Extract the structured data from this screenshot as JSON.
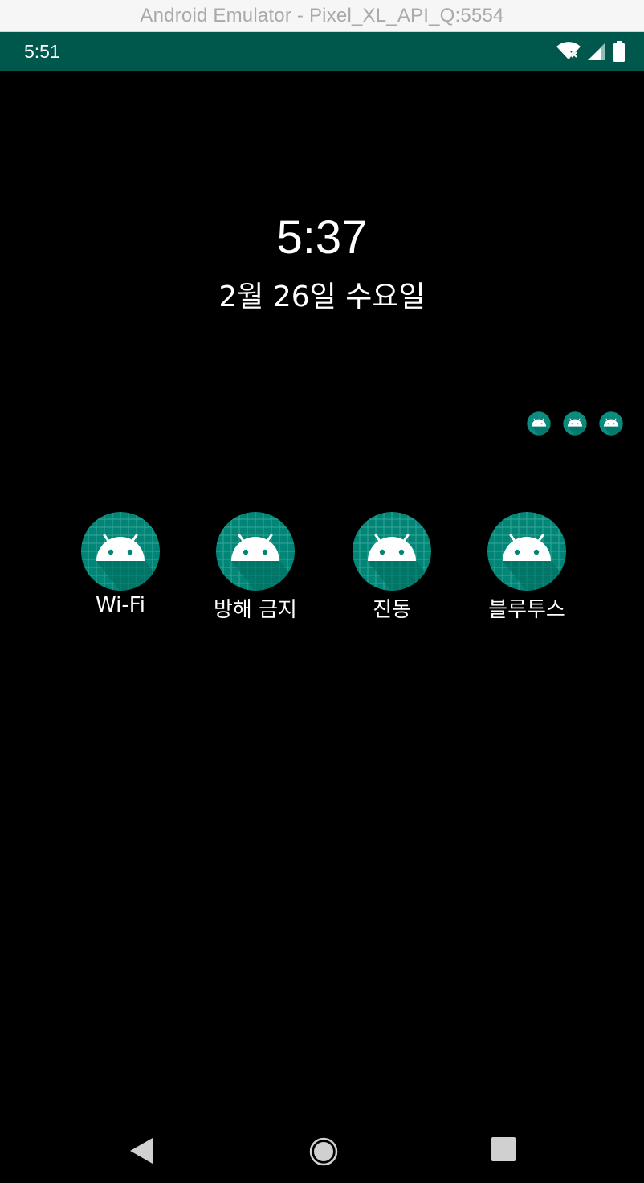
{
  "window": {
    "title": "Android Emulator - Pixel_XL_API_Q:5554"
  },
  "status_bar": {
    "time": "5:51",
    "icons": [
      "wifi-icon",
      "cellular-signal-icon",
      "battery-icon"
    ],
    "color": "#00574b"
  },
  "lock_screen": {
    "clock": "5:37",
    "date": "2월 26일 수요일"
  },
  "notification_icons": [
    "android-app-icon",
    "android-app-icon",
    "android-app-icon"
  ],
  "shortcuts": [
    {
      "label": "Wi-Fi",
      "icon": "android-app-icon"
    },
    {
      "label": "방해 금지",
      "icon": "android-app-icon"
    },
    {
      "label": "진동",
      "icon": "android-app-icon"
    },
    {
      "label": "블루투스",
      "icon": "android-app-icon"
    }
  ],
  "nav_bar": {
    "buttons": [
      "back-icon",
      "home-icon",
      "recents-icon"
    ]
  },
  "colors": {
    "icon_teal": "#008577",
    "icon_grid": "#3aa597",
    "background": "#000000"
  }
}
